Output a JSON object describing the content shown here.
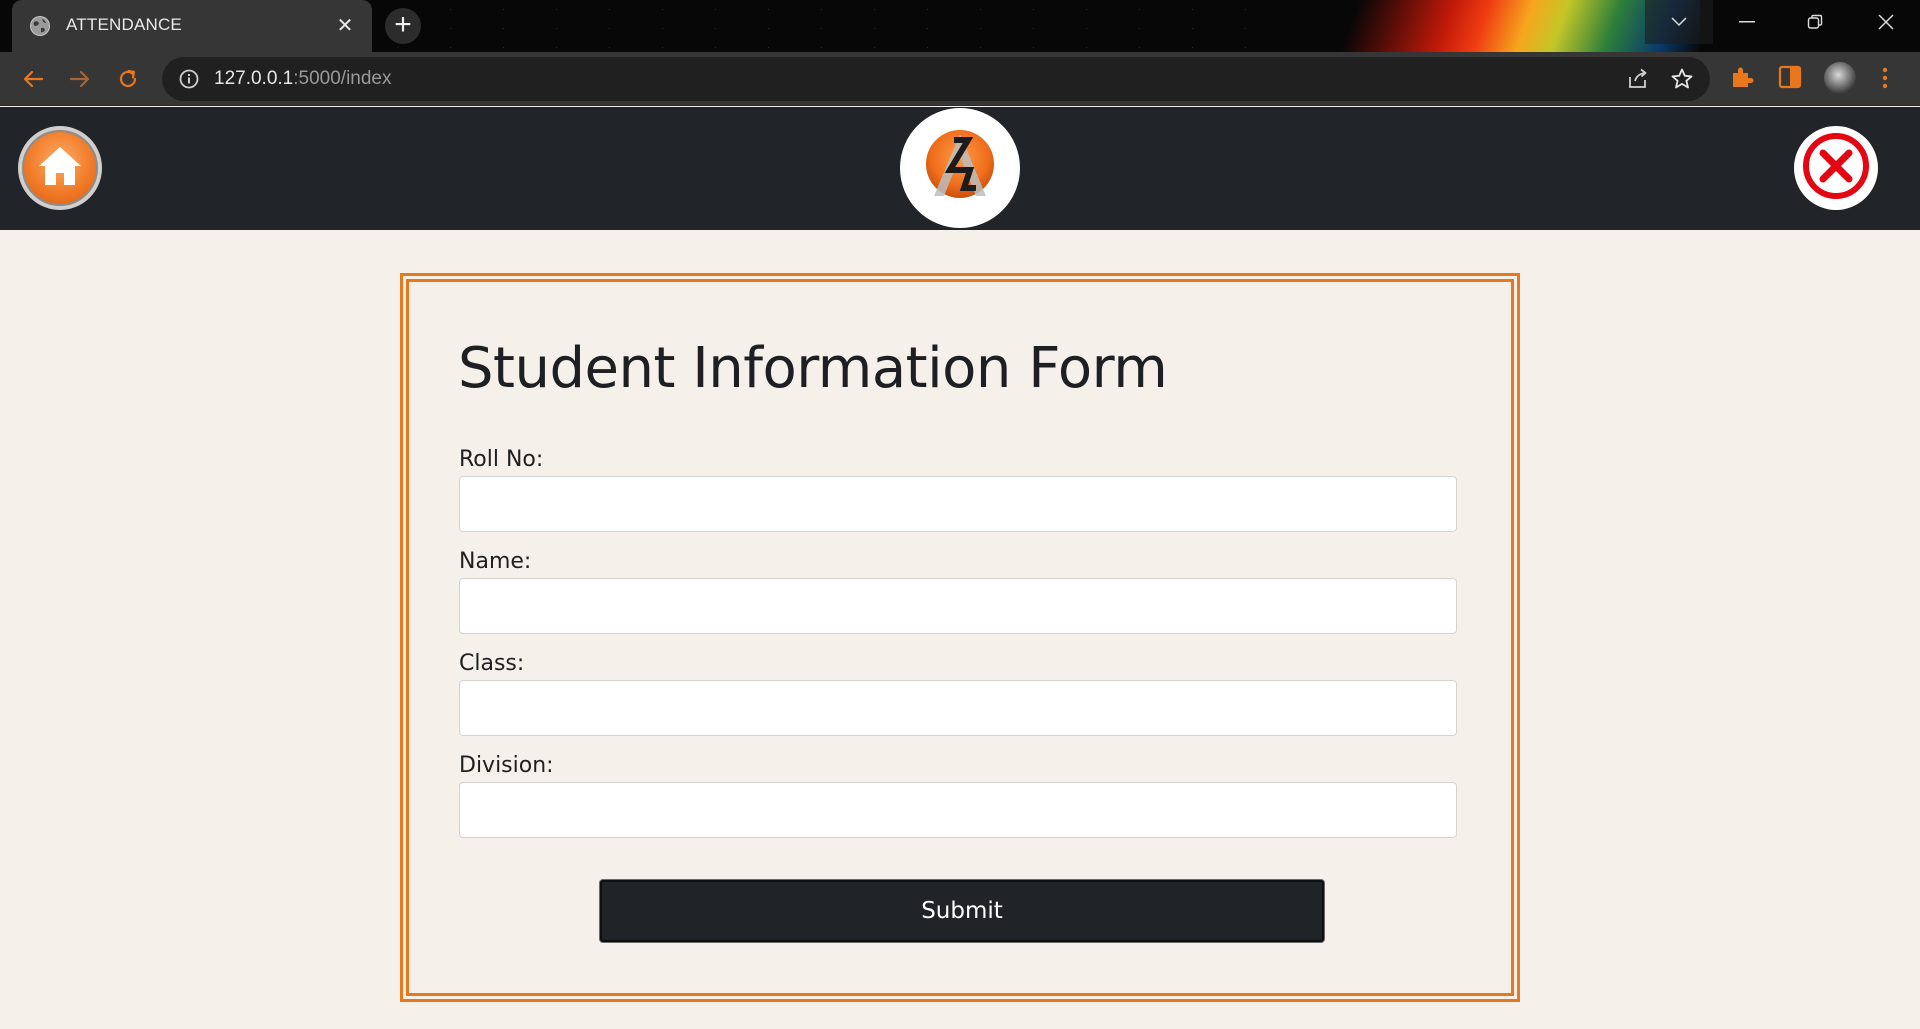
{
  "browser": {
    "tab_title": "ATTENDANCE",
    "tab_close_glyph": "✕",
    "new_tab_glyph": "+",
    "url_host": "127.0.0.1",
    "url_rest": ":5000/index",
    "icons": {
      "tab": "globe-icon",
      "back": "back-arrow-icon",
      "forward": "forward-arrow-icon",
      "reload": "reload-icon",
      "site_info": "info-icon",
      "share": "share-icon",
      "bookmark": "star-icon",
      "extensions": "puzzle-icon",
      "side_panel": "side-panel-icon",
      "menu": "kebab-menu-icon"
    },
    "accent_color": "#e9771b"
  },
  "header": {
    "background": "#212428",
    "home_icon": "home-icon",
    "logo_icon": "logo-icon",
    "close_icon": "close-x-icon"
  },
  "form": {
    "title": "Student Information Form",
    "fields": [
      {
        "label": "Roll No:",
        "value": "",
        "placeholder": ""
      },
      {
        "label": "Name:",
        "value": "",
        "placeholder": ""
      },
      {
        "label": "Class:",
        "value": "",
        "placeholder": ""
      },
      {
        "label": "Division:",
        "value": "",
        "placeholder": ""
      }
    ],
    "submit_label": "Submit",
    "border_color": "#e9771b"
  }
}
